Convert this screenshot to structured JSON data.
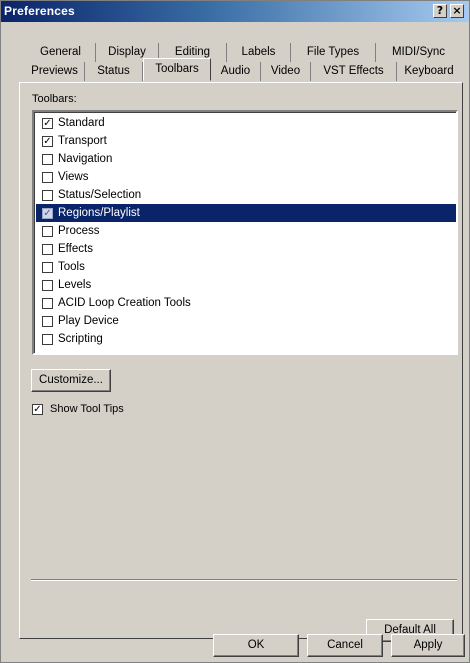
{
  "window": {
    "title": "Preferences",
    "help_glyph": "?",
    "close_glyph": "×"
  },
  "tabs": {
    "row_back": [
      "General",
      "Display",
      "Editing",
      "Labels",
      "File Types",
      "MIDI/Sync"
    ],
    "row_front": [
      "Previews",
      "Status",
      "Toolbars",
      "Audio",
      "Video",
      "VST Effects",
      "Keyboard"
    ],
    "active": "Toolbars"
  },
  "toolbars_panel": {
    "label": "Toolbars:",
    "items": [
      {
        "label": "Standard",
        "checked": true
      },
      {
        "label": "Transport",
        "checked": true
      },
      {
        "label": "Navigation",
        "checked": false
      },
      {
        "label": "Views",
        "checked": false
      },
      {
        "label": "Status/Selection",
        "checked": false
      },
      {
        "label": "Regions/Playlist",
        "checked": true,
        "selected": true
      },
      {
        "label": "Process",
        "checked": false
      },
      {
        "label": "Effects",
        "checked": false
      },
      {
        "label": "Tools",
        "checked": false
      },
      {
        "label": "Levels",
        "checked": false
      },
      {
        "label": "ACID Loop Creation Tools",
        "checked": false
      },
      {
        "label": "Play Device",
        "checked": false
      },
      {
        "label": "Scripting",
        "checked": false
      }
    ],
    "customize_label": "Customize...",
    "show_tooltips_label": "Show Tool Tips",
    "show_tooltips_checked": true,
    "default_all_label": "Default All"
  },
  "dialog_buttons": {
    "ok": "OK",
    "cancel": "Cancel",
    "apply": "Apply"
  },
  "colors": {
    "selection": "#0a246a",
    "face": "#d4d0c8",
    "title_start": "#0a246a"
  }
}
